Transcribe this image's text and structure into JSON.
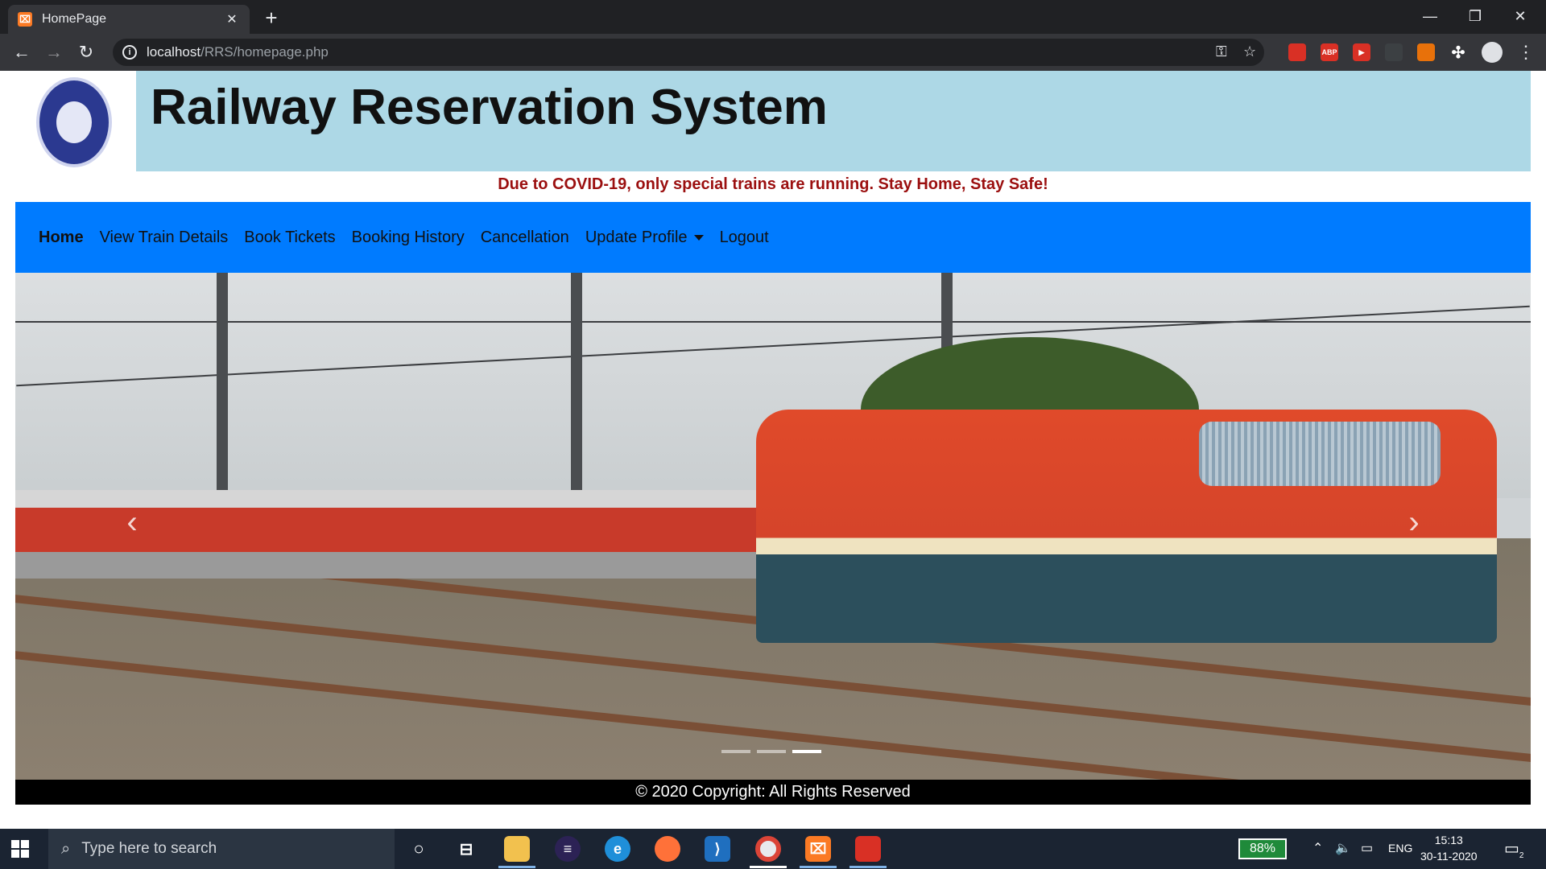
{
  "browser": {
    "tab_title": "HomePage",
    "tab_favicon": "xampp-icon",
    "close_glyph": "✕",
    "new_tab_glyph": "+",
    "url_host": "localhost",
    "url_path": "/RRS/homepage.php",
    "back_glyph": "←",
    "forward_glyph": "→",
    "reload_glyph": "↻",
    "window_minimize": "—",
    "window_restore": "❐",
    "window_close": "✕",
    "extensions": [
      {
        "name": "red-extension",
        "label": "",
        "color": "#d93025"
      },
      {
        "name": "adblock-plus",
        "label": "ABP",
        "color": "#d93025"
      },
      {
        "name": "red-play-extension",
        "label": "▶",
        "color": "#d93025"
      },
      {
        "name": "puzzle-extension",
        "label": "",
        "color": "#5f6368"
      },
      {
        "name": "orange-extension",
        "label": "",
        "color": "#e8710a"
      }
    ],
    "menu_glyph": "⋮"
  },
  "page": {
    "title": "Railway Reservation System",
    "covid_note": "Due to COVID-19, only special trains are running. Stay Home, Stay Safe!",
    "nav": {
      "home": "Home",
      "view_train_details": "View Train Details",
      "book_tickets": "Book Tickets",
      "booking_history": "Booking History",
      "cancellation": "Cancellation",
      "update_profile": "Update Profile",
      "logout": "Logout"
    },
    "carousel": {
      "prev_glyph": "‹",
      "next_glyph": "›",
      "slide_count": 3,
      "active_slide": 3
    },
    "footer": "© 2020 Copyright: All Rights Reserved",
    "colors": {
      "header_band": "#add8e6",
      "navbar": "#007bff",
      "covid_note": "#9b0f0f",
      "footer": "#000000"
    }
  },
  "taskbar": {
    "search_placeholder": "Type here to search",
    "battery": "88%",
    "language": "ENG",
    "time": "15:13",
    "date": "30-11-2020",
    "notification_count": "2"
  }
}
